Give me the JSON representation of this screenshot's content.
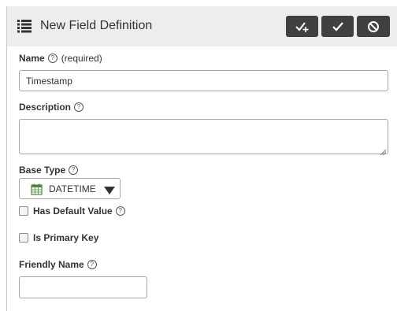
{
  "header": {
    "title": "New Field Definition",
    "icon": "list-icon",
    "buttons": [
      {
        "icon": "check-plus-icon",
        "name": "save-and-new"
      },
      {
        "icon": "check-icon",
        "name": "save"
      },
      {
        "icon": "ban-icon",
        "name": "cancel"
      }
    ],
    "background": "#ededed",
    "button_color": "#404040"
  },
  "form": {
    "name": {
      "label": "Name",
      "help": "?",
      "required_note": "(required)",
      "value": "Timestamp"
    },
    "description": {
      "label": "Description",
      "help": "?",
      "value": ""
    },
    "base_type": {
      "label": "Base Type",
      "help": "?",
      "selected": "DATETIME",
      "icon": "calendar-icon"
    },
    "has_default_value": {
      "label": "Has Default Value",
      "help": "?",
      "checked": false
    },
    "is_primary_key": {
      "label": "Is Primary Key",
      "checked": false
    },
    "friendly_name": {
      "label": "Friendly Name",
      "help": "?",
      "value": ""
    }
  }
}
